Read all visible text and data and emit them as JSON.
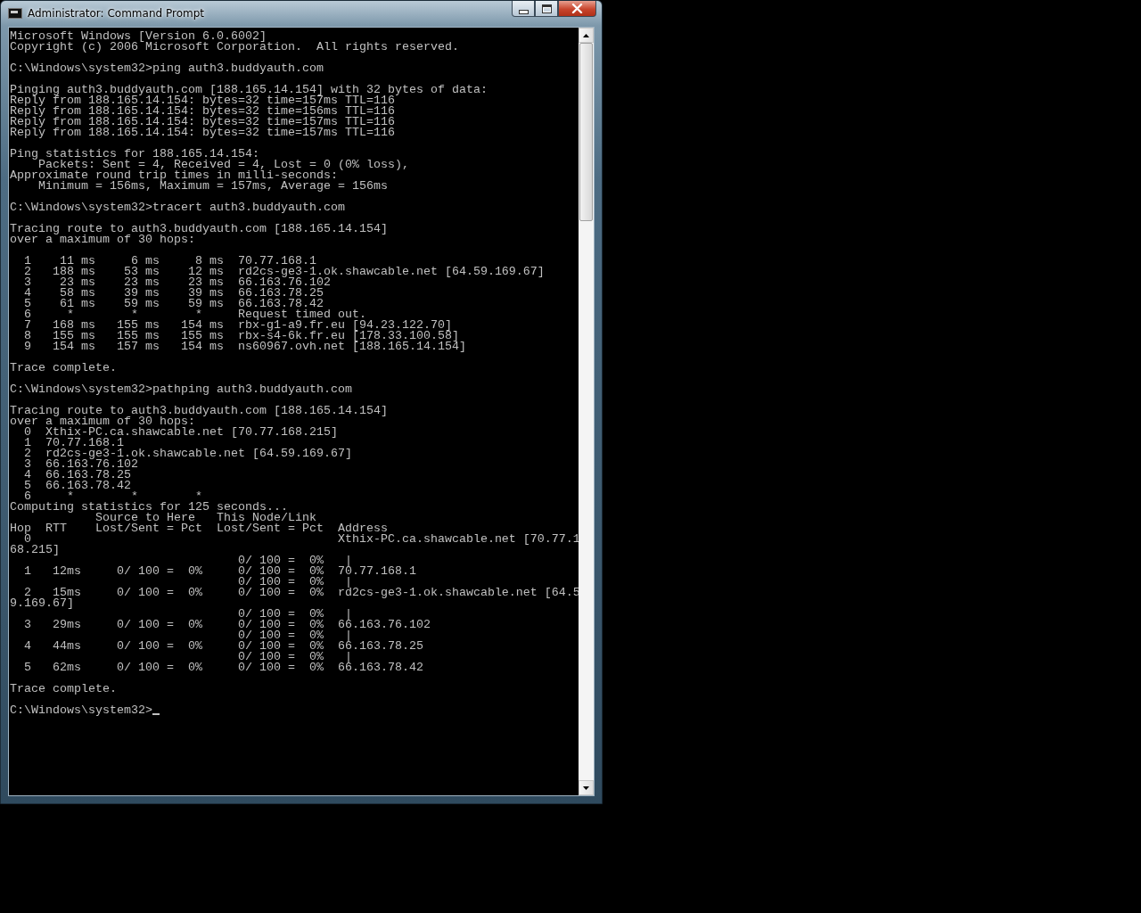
{
  "window": {
    "title": "Administrator: Command Prompt"
  },
  "console": {
    "blocks": [
      [
        "Microsoft Windows [Version 6.0.6002]",
        "Copyright (c) 2006 Microsoft Corporation.  All rights reserved."
      ],
      [
        "C:\\Windows\\system32>ping auth3.buddyauth.com"
      ],
      [
        "Pinging auth3.buddyauth.com [188.165.14.154] with 32 bytes of data:",
        "Reply from 188.165.14.154: bytes=32 time=157ms TTL=116",
        "Reply from 188.165.14.154: bytes=32 time=156ms TTL=116",
        "Reply from 188.165.14.154: bytes=32 time=157ms TTL=116",
        "Reply from 188.165.14.154: bytes=32 time=157ms TTL=116"
      ],
      [
        "Ping statistics for 188.165.14.154:",
        "    Packets: Sent = 4, Received = 4, Lost = 0 (0% loss),",
        "Approximate round trip times in milli-seconds:",
        "    Minimum = 156ms, Maximum = 157ms, Average = 156ms"
      ],
      [
        "C:\\Windows\\system32>tracert auth3.buddyauth.com"
      ],
      [
        "Tracing route to auth3.buddyauth.com [188.165.14.154]",
        "over a maximum of 30 hops:"
      ],
      [
        "  1    11 ms     6 ms     8 ms  70.77.168.1",
        "  2   188 ms    53 ms    12 ms  rd2cs-ge3-1.ok.shawcable.net [64.59.169.67]",
        "  3    23 ms    23 ms    23 ms  66.163.76.102",
        "  4    58 ms    39 ms    39 ms  66.163.78.25",
        "  5    61 ms    59 ms    59 ms  66.163.78.42",
        "  6     *        *        *     Request timed out.",
        "  7   168 ms   155 ms   154 ms  rbx-g1-a9.fr.eu [94.23.122.70]",
        "  8   155 ms   155 ms   155 ms  rbx-s4-6k.fr.eu [178.33.100.58]",
        "  9   154 ms   157 ms   154 ms  ns60967.ovh.net [188.165.14.154]"
      ],
      [
        "Trace complete."
      ],
      [
        "C:\\Windows\\system32>pathping auth3.buddyauth.com"
      ],
      [
        "Tracing route to auth3.buddyauth.com [188.165.14.154]",
        "over a maximum of 30 hops:",
        "  0  Xthix-PC.ca.shawcable.net [70.77.168.215]",
        "  1  70.77.168.1",
        "  2  rd2cs-ge3-1.ok.shawcable.net [64.59.169.67]",
        "  3  66.163.76.102",
        "  4  66.163.78.25",
        "  5  66.163.78.42",
        "  6     *        *        *",
        "Computing statistics for 125 seconds...",
        "            Source to Here   This Node/Link",
        "Hop  RTT    Lost/Sent = Pct  Lost/Sent = Pct  Address",
        "  0                                           Xthix-PC.ca.shawcable.net [70.77.1",
        "68.215]",
        "                                0/ 100 =  0%   |",
        "  1   12ms     0/ 100 =  0%     0/ 100 =  0%  70.77.168.1",
        "                                0/ 100 =  0%   |",
        "  2   15ms     0/ 100 =  0%     0/ 100 =  0%  rd2cs-ge3-1.ok.shawcable.net [64.5",
        "9.169.67]",
        "                                0/ 100 =  0%   |",
        "  3   29ms     0/ 100 =  0%     0/ 100 =  0%  66.163.76.102",
        "                                0/ 100 =  0%   |",
        "  4   44ms     0/ 100 =  0%     0/ 100 =  0%  66.163.78.25",
        "                                0/ 100 =  0%   |",
        "  5   62ms     0/ 100 =  0%     0/ 100 =  0%  66.163.78.42"
      ],
      [
        "Trace complete."
      ],
      [
        "C:\\Windows\\system32>"
      ]
    ],
    "cursor": true
  }
}
